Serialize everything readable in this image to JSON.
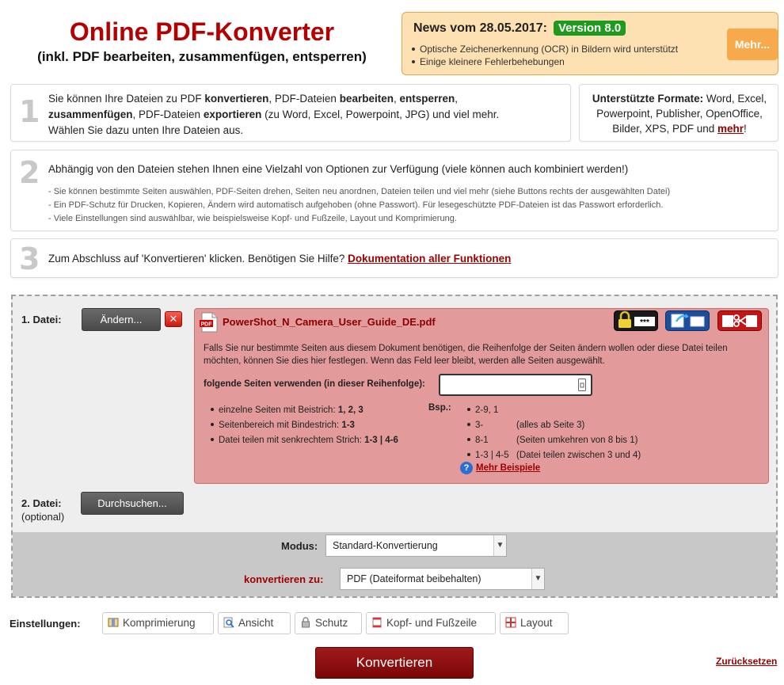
{
  "header": {
    "title": "Online PDF-Konverter",
    "subtitle": "(inkl. PDF bearbeiten, zusammenfügen, entsperren)"
  },
  "news": {
    "heading": "News vom 28.05.2017:",
    "version": "Version 8.0",
    "items": [
      "Optische Zeichenerkennung (OCR) in Bildern wird unterstützt",
      "Einige kleinere Fehlerbehebungen"
    ],
    "more_label": "Mehr..."
  },
  "step1": {
    "number": "1",
    "p1": "Sie können Ihre Dateien zu PDF ",
    "b1": "konvertieren",
    "p2": ", PDF-Dateien ",
    "b2": "bearbeiten",
    "p3": ", ",
    "b3": "entsperren",
    "p4": ",",
    "b4": "zusammenfügen",
    "p5": ", PDF-Dateien ",
    "b5": "exportieren",
    "p6": " (zu Word, Excel, Powerpoint, JPG) und viel mehr.",
    "line3": "Wählen Sie dazu unten Ihre Dateien aus."
  },
  "formats": {
    "label": "Unterstützte Formate:",
    "text1": " Word, Excel,",
    "text2": "Powerpoint, Publisher, OpenOffice,",
    "text3": "Bilder, XPS, PDF und ",
    "link": "mehr",
    "end": "!"
  },
  "step2": {
    "number": "2",
    "text": "Abhängig von den Dateien stehen Ihnen eine Vielzahl von Optionen zur Verfügung (viele können auch kombiniert werden!)",
    "notes": [
      "- Sie können bestimmte Seiten auswählen, PDF-Seiten drehen, Seiten neu anordnen, Dateien teilen und viel mehr (siehe Buttons rechts der ausgewählten Datei)",
      "- Ein PDF-Schutz für Drucken, Kopieren, Ändern wird automatisch aufgehoben (ohne Passwort). Für lesegeschützte PDF-Dateien ist das Passwort erforderlich.",
      "- Viele Einstellungen sind auswählbar, wie beispielsweise Kopf- und Fußzeile, Layout und Komprimierung."
    ]
  },
  "step3": {
    "number": "3",
    "text": "Zum Abschluss auf 'Konvertieren' klicken. Benötigen Sie Hilfe? ",
    "link": "Dokumentation aller Funktionen"
  },
  "file1": {
    "label": "1. Datei:",
    "change_button": "Ändern...",
    "remove_symbol": "✕",
    "filename": "PowerShot_N_Camera_User_Guide_DE.pdf",
    "pdf_badge": "PDF",
    "description": "Falls Sie nur bestimmte Seiten aus diesem Dokument benötigen, die Reihenfolge der Seiten ändern wollen oder diese Datei teilen möchten, können Sie dies hier festlegen. Wenn das Feld leer bleibt, werden alle Seiten ausgewählt.",
    "pages_label": "folgende Seiten verwenden (in dieser Reihenfolge):",
    "pages_value": "",
    "pages_placeholder": "",
    "password_mask": "***",
    "hints": [
      {
        "text": "einzelne Seiten mit Beistrich: ",
        "bold": "1, 2, 3"
      },
      {
        "text": "Seitenbereich mit Bindestrich: ",
        "bold": "1-3"
      },
      {
        "text": "Datei teilen mit senkrechtem Strich: ",
        "bold": "1-3 | 4-6"
      }
    ],
    "examples_label": "Bsp.:",
    "examples": [
      {
        "code": "2-9, 1",
        "note": ""
      },
      {
        "code": "3-",
        "note": "(alles ab Seite 3)"
      },
      {
        "code": "8-1",
        "note": "(Seiten umkehren von 8 bis 1)"
      },
      {
        "code": "1-3 | 4-5",
        "note": "(Datei teilen zwischen 3 und 4)"
      }
    ],
    "help_symbol": "?",
    "more_examples": "Mehr Beispiele"
  },
  "file2": {
    "label": "2. Datei:",
    "optional": "(optional)",
    "browse_button": "Durchsuchen..."
  },
  "mode": {
    "label": "Modus:",
    "value": "Standard-Konvertierung"
  },
  "target": {
    "label": "konvertieren zu:",
    "value": "PDF (Dateiformat beibehalten)"
  },
  "settings": {
    "label": "Einstellungen:",
    "buttons": [
      "Komprimierung",
      "Ansicht",
      "Schutz",
      "Kopf- und Fußzeile",
      "Layout"
    ]
  },
  "actions": {
    "convert": "Konvertieren",
    "reset": "Zurücksetzen"
  },
  "colors": {
    "title_red": "#b30000",
    "file_panel": "#e29a9a",
    "version_badge": "#1e9b1e",
    "news_bg": "#fde1b2",
    "more_button": "#f7a94b",
    "convert_button": "#8f1010"
  }
}
